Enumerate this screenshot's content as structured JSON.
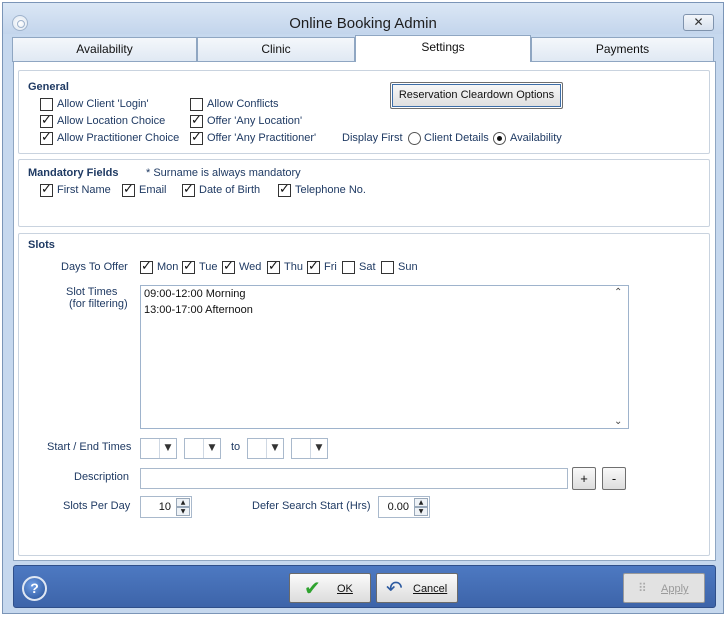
{
  "window": {
    "title": "Online Booking Admin",
    "close_label": "✕"
  },
  "tabs": [
    {
      "label": "Availability",
      "active": false
    },
    {
      "label": "Clinic",
      "active": false
    },
    {
      "label": "Settings",
      "active": true
    },
    {
      "label": "Payments",
      "active": false
    }
  ],
  "general": {
    "title": "General",
    "allow_client_login": {
      "label": "Allow Client 'Login'",
      "checked": false
    },
    "allow_location_choice": {
      "label": "Allow Location Choice",
      "checked": true
    },
    "allow_practitioner_choice": {
      "label": "Allow Practitioner Choice",
      "checked": true
    },
    "allow_conflicts": {
      "label": "Allow Conflicts",
      "checked": false
    },
    "offer_any_location": {
      "label": "Offer 'Any Location'",
      "checked": true
    },
    "offer_any_practitioner": {
      "label": "Offer 'Any Practitioner'",
      "checked": true
    },
    "display_first_label": "Display First",
    "display_first_options": [
      "Client Details",
      "Availability"
    ],
    "display_first_selected": "Availability",
    "reservation_button": "Reservation Cleardown Options"
  },
  "mandatory": {
    "title": "Mandatory Fields",
    "note": "* Surname is always mandatory",
    "fields": [
      {
        "label": "First Name",
        "checked": true
      },
      {
        "label": "Email",
        "checked": true
      },
      {
        "label": "Date of Birth",
        "checked": true
      },
      {
        "label": "Telephone No.",
        "checked": true
      }
    ]
  },
  "slots": {
    "title": "Slots",
    "days_label": "Days To Offer",
    "days": [
      {
        "label": "Mon",
        "checked": true
      },
      {
        "label": "Tue",
        "checked": true
      },
      {
        "label": "Wed",
        "checked": true
      },
      {
        "label": "Thu",
        "checked": true
      },
      {
        "label": "Fri",
        "checked": true
      },
      {
        "label": "Sat",
        "checked": false
      },
      {
        "label": "Sun",
        "checked": false
      }
    ],
    "slot_times_label": "Slot Times",
    "slot_times_sub": "(for filtering)",
    "slot_times": [
      "09:00-12:00 Morning",
      "13:00-17:00 Afternoon"
    ],
    "start_end_label": "Start / End Times",
    "to_label": "to",
    "description_label": "Description",
    "description_value": "",
    "add_label": "+",
    "remove_label": "-",
    "slots_per_day_label": "Slots Per Day",
    "slots_per_day_value": "10",
    "defer_label": "Defer Search Start (Hrs)",
    "defer_value": "0.00"
  },
  "footer": {
    "help_label": "?",
    "ok_label": "OK",
    "cancel_label": "Cancel",
    "apply_label": "Apply",
    "apply_enabled": false
  }
}
